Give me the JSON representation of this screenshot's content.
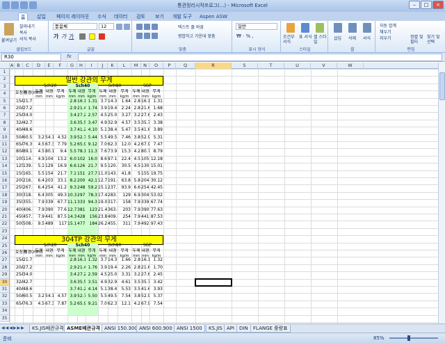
{
  "window": {
    "title": "통관정리시작프로그(...) - Microsoft Excel"
  },
  "tabs": [
    "홈",
    "삽입",
    "페이지 레이아웃",
    "수식",
    "데이터",
    "검토",
    "보기",
    "개발 도구",
    "Aspen ASW"
  ],
  "ribbon": {
    "clipboard": {
      "paste": "붙여넣기",
      "cut": "잘라내기",
      "copy": "복사",
      "format_painter": "서식 복사",
      "label": "클립보드"
    },
    "font": {
      "name": "돋움체",
      "size": "12",
      "label": "글꼴"
    },
    "alignment": {
      "wrap": "텍스트 줄 바꿈",
      "merge": "병합하고 가운데 맞춤",
      "label": "맞춤"
    },
    "number": {
      "format": "일반",
      "label": "표시 형식"
    },
    "styles": {
      "cond": "조건부 서식",
      "table": "표 서식",
      "cell": "셀 스타일",
      "label": "스타일"
    },
    "cells": {
      "insert": "삽입",
      "delete": "삭제",
      "format": "서식",
      "label": "셀"
    },
    "editing": {
      "autosum": "자동 합계",
      "fill": "채우기",
      "clear": "지우기",
      "sort": "정렬 및 필터",
      "find": "찾기 및 선택",
      "label": "편집"
    }
  },
  "formula_bar": {
    "name_box": "R30",
    "fx": "fx",
    "content": ""
  },
  "columns": [
    "A",
    "B",
    "C",
    "D",
    "E",
    "F",
    "G",
    "H",
    "I",
    "J",
    "K",
    "L",
    "M",
    "N",
    "O",
    "P",
    "Q",
    "R",
    "S",
    "T",
    "U",
    "V",
    "W"
  ],
  "selected_column": "R",
  "selected_row": "30",
  "rows": [
    "1",
    "2",
    "3",
    "4",
    "5",
    "6",
    "7",
    "8",
    "9",
    "10",
    "11",
    "12",
    "13",
    "14",
    "15",
    "16",
    "17",
    "18",
    "19",
    "20",
    "21",
    "22",
    "23",
    "24",
    "25",
    "26",
    "27",
    "28",
    "29",
    "30",
    "31",
    "32",
    "33",
    "34",
    "35"
  ],
  "table1": {
    "title": "일반 강관의 무게",
    "hdr_nominal": "호칭경",
    "hdr_od": "외경(mm)",
    "groups": [
      "Sch20",
      "Sch40",
      "Sch80",
      "SGP"
    ],
    "sub": [
      "두께",
      "내경",
      "무게"
    ],
    "units": [
      "mm",
      "mm",
      "kg/m"
    ],
    "rows": [
      [
        "15A",
        "21.7",
        "",
        "",
        "",
        "2.8",
        "16.1",
        "1.31",
        "3.7",
        "14.3",
        "1.64",
        "2.8",
        "16.1",
        "1.31"
      ],
      [
        "20A",
        "27.2",
        "",
        "",
        "",
        "2.9",
        "21.4",
        "1.74",
        "3.9",
        "19.4",
        "2.24",
        "2.8",
        "21.6",
        "1.68"
      ],
      [
        "25A",
        "34.0",
        "",
        "",
        "",
        "3.4",
        "27.2",
        "2.57",
        "4.5",
        "25.0",
        "3.27",
        "3.2",
        "27.6",
        "2.43"
      ],
      [
        "32A",
        "42.7",
        "",
        "",
        "",
        "3.6",
        "35.5",
        "3.47",
        "4.9",
        "32.9",
        "4.57",
        "3.5",
        "35.7",
        "3.38"
      ],
      [
        "40A",
        "48.6",
        "",
        "",
        "",
        "3.7",
        "41.2",
        "4.10",
        "5.1",
        "38.4",
        "5.47",
        "3.5",
        "41.6",
        "3.89"
      ],
      [
        "50A",
        "60.5",
        "3.2",
        "54.1",
        "4.52",
        "3.9",
        "52.7",
        "5.44",
        "5.5",
        "49.5",
        "7.46",
        "3.8",
        "52.9",
        "5.31"
      ],
      [
        "65A",
        "76.3",
        "4.5",
        "67.3",
        "7.79",
        "5.2",
        "65.9",
        "9.12",
        "7.0",
        "62.3",
        "12.0",
        "4.2",
        "67.9",
        "7.47"
      ],
      [
        "80A",
        "89.1",
        "4.5",
        "80.1",
        "9.4",
        "5.5",
        "78.1",
        "11.3",
        "7.6",
        "73.9",
        "15.3",
        "4.2",
        "80.7",
        "8.79"
      ],
      [
        "100A",
        "114.3",
        "4.9",
        "104.5",
        "13.2",
        "6.0",
        "102.3",
        "16.0",
        "8.6",
        "97.1",
        "22.4",
        "4.5",
        "105.3",
        "12.18"
      ],
      [
        "125A",
        "139.8",
        "5.1",
        "129.6",
        "16.9",
        "6.6",
        "126.6",
        "21.7",
        "9.5",
        "120.8",
        "30.5",
        "4.5",
        "130.8",
        "15.01"
      ],
      [
        "150A",
        "165.2",
        "5.5",
        "154.2",
        "21.7",
        "7.1",
        "151.0",
        "27.7",
        "11.0",
        "143.2",
        "41.8",
        "5",
        "155.2",
        "19.75"
      ],
      [
        "200A",
        "216.3",
        "6.4",
        "203.6",
        "33.1",
        "8.2",
        "200.0",
        "42.1",
        "12.7",
        "191.0",
        "63.8",
        "5.8",
        "204.8",
        "30.12"
      ],
      [
        "250A",
        "267.4",
        "6.4",
        "254.6",
        "41.2",
        "9.3",
        "248.8",
        "59.2",
        "15.1",
        "237.2",
        "93.9",
        "6.6",
        "254.2",
        "42.45"
      ],
      [
        "300A",
        "318.5",
        "6.4",
        "305.7",
        "49.3",
        "10.3",
        "297.9",
        "78.3",
        "17.4",
        "283.7",
        "129",
        "6.9",
        "304.7",
        "53.02"
      ],
      [
        "350A",
        "355.6",
        "7.9",
        "339.8",
        "67.7",
        "11.1",
        "333.4",
        "94.3",
        "19.0",
        "317.6",
        "158",
        "7.9",
        "339.8",
        "67.74"
      ],
      [
        "400A",
        "406.4",
        "7.9",
        "390.6",
        "77.6",
        "12.7",
        "381.0",
        "123",
        "21.4",
        "363.6",
        "203",
        "7.9",
        "390.6",
        "77.63"
      ],
      [
        "450A",
        "457.2",
        "7.9",
        "441.4",
        "87.5",
        "14.3",
        "428.6",
        "156",
        "23.8",
        "409.6",
        "254",
        "7.9",
        "441.4",
        "87.53"
      ],
      [
        "500A",
        "508.0",
        "9.5",
        "489.0",
        "117",
        "15.1",
        "477.8",
        "184",
        "26.2",
        "455.6",
        "311",
        "7.9",
        "492.2",
        "97.43"
      ]
    ]
  },
  "table2": {
    "title": "304TP 강관의 무게",
    "hdr_nominal": "호칭경",
    "hdr_od": "외경(mm)",
    "groups": [
      "Sch20",
      "Sch40",
      "Sch80",
      "SGP"
    ],
    "sub": [
      "두께",
      "내경",
      "무게"
    ],
    "units": [
      "mm",
      "mm",
      "kg/m"
    ],
    "rows": [
      [
        "15A",
        "21.7",
        "",
        "",
        "",
        "2.8",
        "16.1",
        "1.32",
        "3.7",
        "14.3",
        "1.66",
        "2.8",
        "16.1",
        "1.32"
      ],
      [
        "20A",
        "27.2",
        "",
        "",
        "",
        "2.9",
        "21.4",
        "1.76",
        "3.9",
        "19.4",
        "2.26",
        "2.8",
        "21.6",
        "1.70"
      ],
      [
        "25A",
        "34.0",
        "",
        "",
        "",
        "3.4",
        "27.2",
        "2.59",
        "4.5",
        "25.0",
        "3.31",
        "3.2",
        "27.6",
        "2.45"
      ],
      [
        "32A",
        "42.7",
        "",
        "",
        "",
        "3.6",
        "35.5",
        "3.51",
        "4.9",
        "32.9",
        "4.61",
        "3.5",
        "35.7",
        "3.42"
      ],
      [
        "40A",
        "48.6",
        "",
        "",
        "",
        "3.7",
        "41.2",
        "4.14",
        "5.1",
        "38.4",
        "5.53",
        "3.5",
        "41.6",
        "3.93"
      ],
      [
        "50A",
        "60.5",
        "3.2",
        "54.1",
        "4.57",
        "3.9",
        "52.7",
        "5.50",
        "5.5",
        "49.5",
        "7.54",
        "3.8",
        "52.9",
        "5.37"
      ],
      [
        "65A",
        "76.3",
        "4.5",
        "67.3",
        "7.87",
        "5.2",
        "65.9",
        "9.21",
        "7.0",
        "62.3",
        "12.1",
        "4.2",
        "67.9",
        "7.54"
      ]
    ]
  },
  "sheet_tabs": [
    "KS.JIS배관규격",
    "ASME배관규격",
    "ANSI 150.300",
    "ANSI 600.900",
    "ANSI 1500",
    "KS.JIS",
    "API",
    "DIN",
    "FLANGE 중량표"
  ],
  "active_sheet": "ASME배관규격",
  "status": {
    "ready": "준비",
    "zoom": "85%"
  }
}
